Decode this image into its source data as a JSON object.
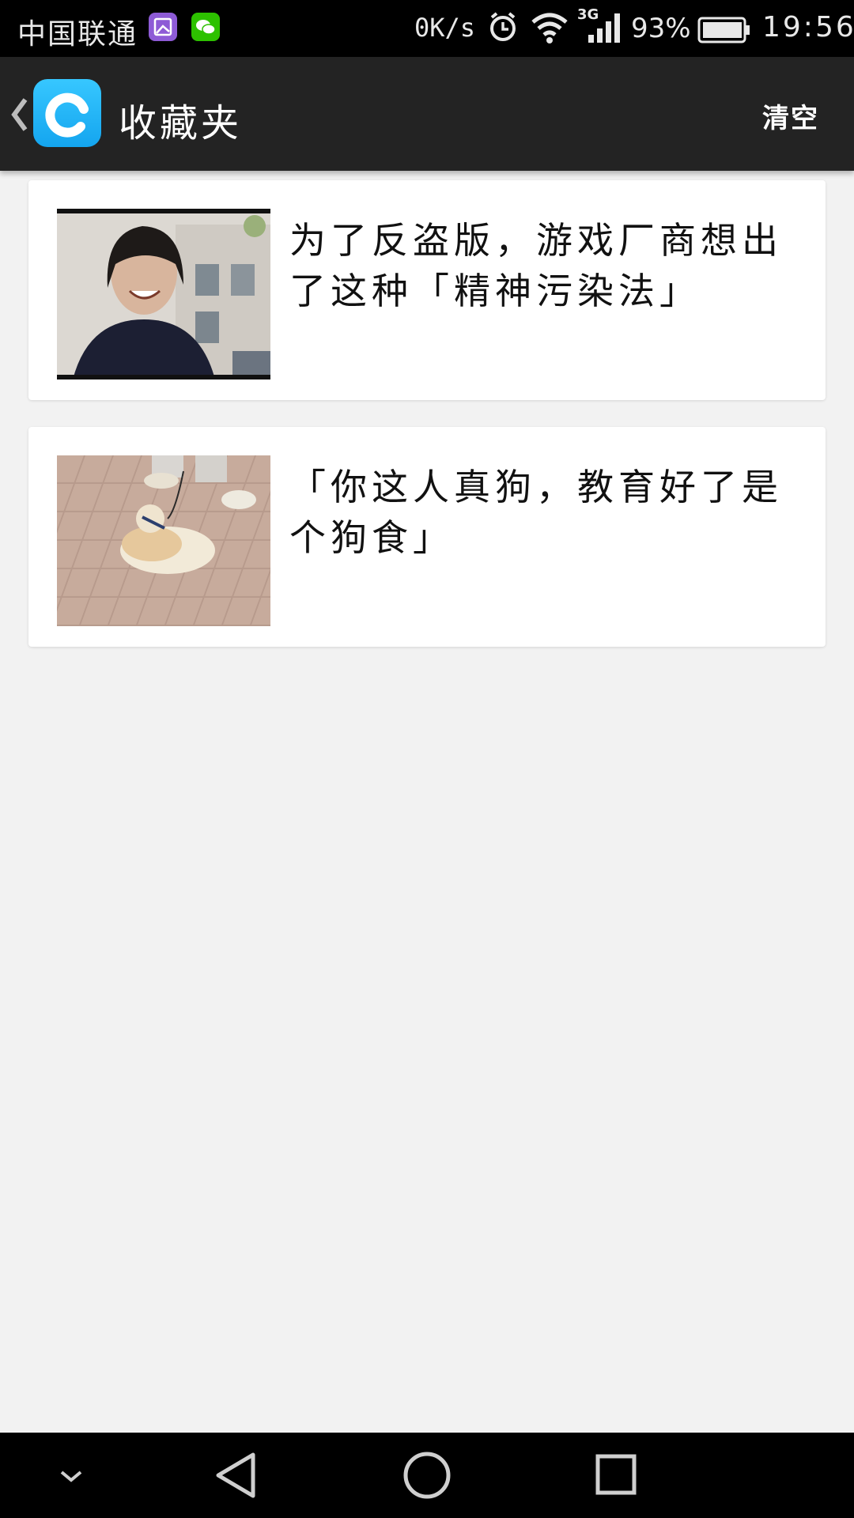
{
  "status_bar": {
    "carrier": "中国联通",
    "net_speed": "0K/s",
    "network_type": "3G",
    "battery": "93%",
    "time": "19:56",
    "icons": [
      "gallery-icon",
      "wechat-icon",
      "alarm-icon",
      "wifi-icon",
      "signal-icon",
      "battery-icon"
    ]
  },
  "action_bar": {
    "title": "收藏夹",
    "clear_label": "清空",
    "icons": [
      "back-chevron-icon",
      "app-logo-icon"
    ],
    "accent_color": "#1aaef2"
  },
  "favorites": [
    {
      "title": "为了反盗版，游戏厂商想出了这种「精神污染法」",
      "thumbnail": "laughing-long-hair-man-photo"
    },
    {
      "title": "「你这人真狗，教育好了是个狗食」",
      "thumbnail": "dog-lying-on-tiles-photo"
    }
  ],
  "nav_bar": {
    "icons": [
      "collapse-chevron-icon",
      "back-triangle-icon",
      "home-circle-icon",
      "recents-square-icon"
    ]
  }
}
